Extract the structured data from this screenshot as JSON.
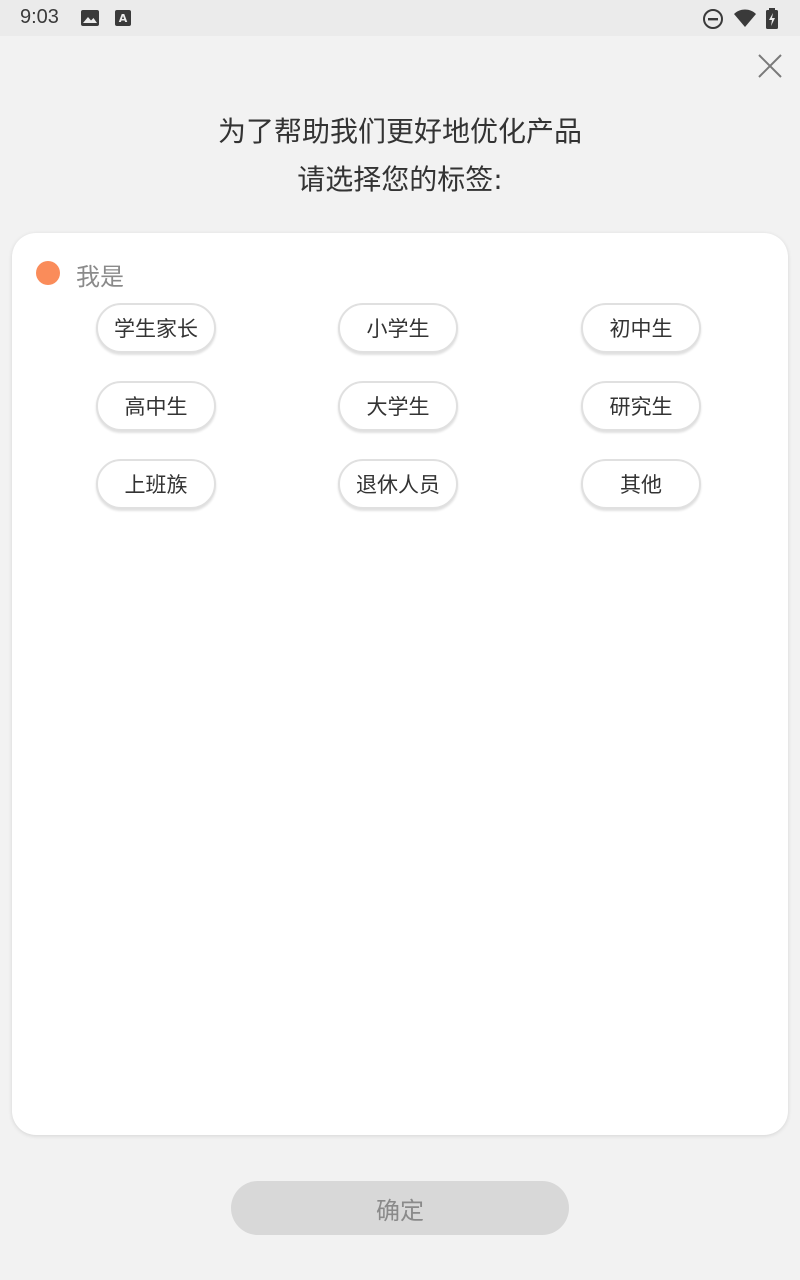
{
  "status_bar": {
    "time": "9:03",
    "icons": [
      "image-icon",
      "text-a-icon",
      "do-not-disturb-icon",
      "wifi-icon",
      "battery-charging-icon"
    ]
  },
  "header": {
    "line1": "为了帮助我们更好地优化产品",
    "line2": "请选择您的标签:"
  },
  "section": {
    "label": "我是",
    "dot_color": "#fa8c5a"
  },
  "tags": [
    {
      "label": "学生家长"
    },
    {
      "label": "小学生"
    },
    {
      "label": "初中生"
    },
    {
      "label": "高中生"
    },
    {
      "label": "大学生"
    },
    {
      "label": "研究生"
    },
    {
      "label": "上班族"
    },
    {
      "label": "退休人员"
    },
    {
      "label": "其他"
    }
  ],
  "confirm": {
    "label": "确定"
  }
}
